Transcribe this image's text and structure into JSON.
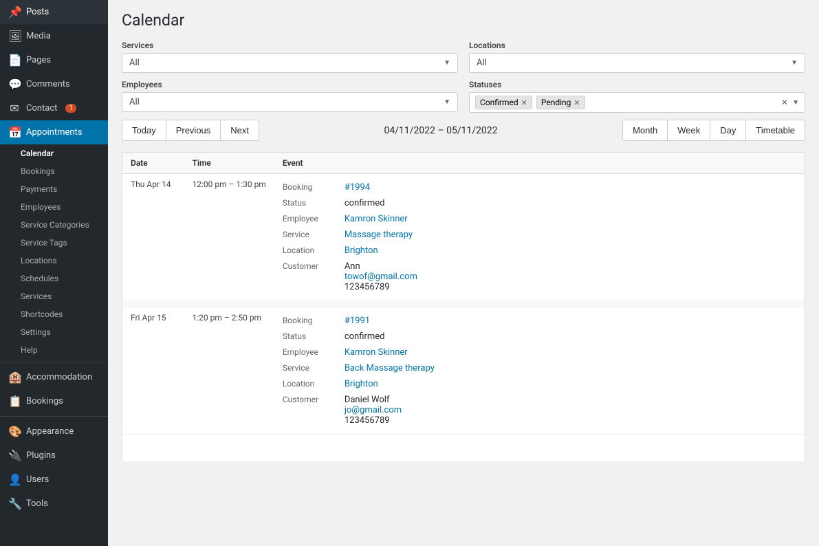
{
  "sidebar": {
    "items": [
      {
        "id": "posts",
        "label": "Posts",
        "icon": "📌"
      },
      {
        "id": "media",
        "label": "Media",
        "icon": "🖼"
      },
      {
        "id": "pages",
        "label": "Pages",
        "icon": "📄"
      },
      {
        "id": "comments",
        "label": "Comments",
        "icon": "💬"
      },
      {
        "id": "contact",
        "label": "Contact",
        "icon": "✉",
        "badge": "1"
      },
      {
        "id": "appointments",
        "label": "Appointments",
        "icon": "📅",
        "active": true
      }
    ],
    "sub_items": [
      {
        "id": "calendar",
        "label": "Calendar"
      },
      {
        "id": "bookings",
        "label": "Bookings"
      },
      {
        "id": "payments",
        "label": "Payments"
      },
      {
        "id": "employees",
        "label": "Employees"
      },
      {
        "id": "service-categories",
        "label": "Service Categories"
      },
      {
        "id": "service-tags",
        "label": "Service Tags"
      },
      {
        "id": "locations",
        "label": "Locations"
      },
      {
        "id": "schedules",
        "label": "Schedules"
      },
      {
        "id": "services",
        "label": "Services"
      },
      {
        "id": "shortcodes",
        "label": "Shortcodes"
      },
      {
        "id": "settings",
        "label": "Settings"
      },
      {
        "id": "help",
        "label": "Help"
      }
    ],
    "bottom_items": [
      {
        "id": "accommodation",
        "label": "Accommodation",
        "icon": "🏨"
      },
      {
        "id": "bookings2",
        "label": "Bookings",
        "icon": "📋"
      },
      {
        "id": "appearance",
        "label": "Appearance",
        "icon": "🎨"
      },
      {
        "id": "plugins",
        "label": "Plugins",
        "icon": "🔌"
      },
      {
        "id": "users",
        "label": "Users",
        "icon": "👤"
      },
      {
        "id": "tools",
        "label": "Tools",
        "icon": "🔧"
      }
    ]
  },
  "page": {
    "title": "Calendar"
  },
  "filters": {
    "services_label": "Services",
    "services_value": "All",
    "locations_label": "Locations",
    "locations_value": "All",
    "employees_label": "Employees",
    "employees_value": "All",
    "statuses_label": "Statuses",
    "statuses_tags": [
      {
        "label": "Confirmed"
      },
      {
        "label": "Pending"
      }
    ]
  },
  "nav": {
    "today": "Today",
    "previous": "Previous",
    "next": "Next",
    "date_range": "04/11/2022 – 05/11/2022",
    "views": [
      "Month",
      "Week",
      "Day",
      "Timetable"
    ]
  },
  "table": {
    "headers": [
      "Date",
      "Time",
      "Event"
    ],
    "bookings": [
      {
        "date": "Thu Apr 14",
        "time": "12:00 pm – 1:30 pm",
        "booking_id": "#1994",
        "booking_href": "#",
        "status": "confirmed",
        "employee": "Kamron Skinner",
        "employee_href": "#",
        "service": "Massage therapy",
        "service_href": "#",
        "location": "Brighton",
        "location_href": "#",
        "customer_name": "Ann",
        "customer_email": "towof@gmail.com",
        "customer_email_href": "#",
        "customer_phone": "123456789"
      },
      {
        "date": "Fri Apr 15",
        "time": "1:20 pm – 2:50 pm",
        "booking_id": "#1991",
        "booking_href": "#",
        "status": "confirmed",
        "employee": "Kamron Skinner",
        "employee_href": "#",
        "service": "Back Massage therapy",
        "service_href": "#",
        "location": "Brighton",
        "location_href": "#",
        "customer_name": "Daniel Wolf",
        "customer_email": "jo@gmail.com",
        "customer_email_href": "#",
        "customer_phone": "123456789"
      }
    ],
    "row_labels": {
      "booking": "Booking",
      "status": "Status",
      "employee": "Employee",
      "service": "Service",
      "location": "Location",
      "customer": "Customer"
    }
  }
}
